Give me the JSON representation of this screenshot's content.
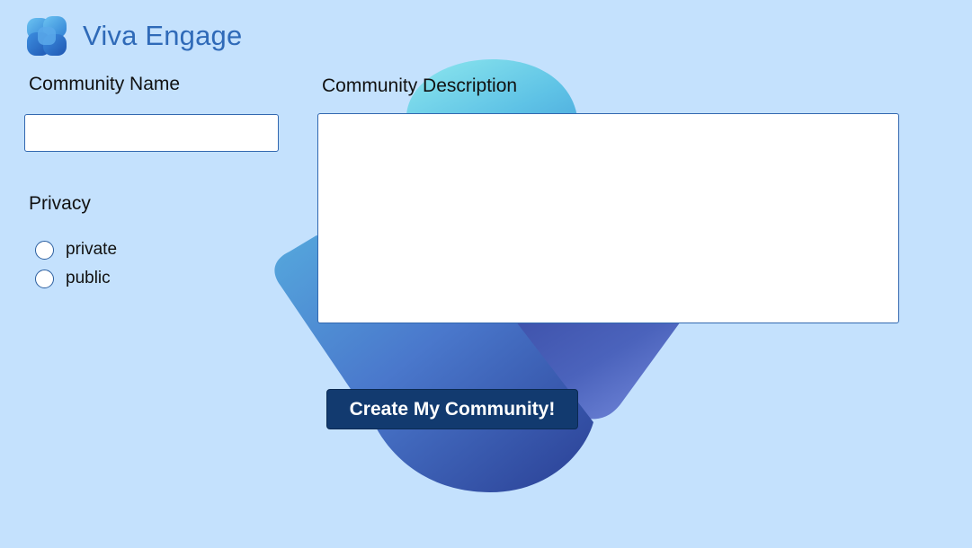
{
  "app": {
    "title": "Viva Engage"
  },
  "form": {
    "community_name": {
      "label": "Community Name",
      "value": ""
    },
    "community_description": {
      "label": "Community Description",
      "value": ""
    },
    "privacy": {
      "label": "Privacy",
      "options": [
        {
          "label": "private",
          "selected": false
        },
        {
          "label": "public",
          "selected": false
        }
      ]
    },
    "submit_label": "Create My Community!"
  },
  "colors": {
    "background": "#c4e1fd",
    "title": "#2f6ab8",
    "button": "#123a6f",
    "input_border": "#3268b0"
  },
  "icons": {
    "logo": "viva-engage-logo-icon",
    "background_art": "viva-engage-watermark"
  }
}
